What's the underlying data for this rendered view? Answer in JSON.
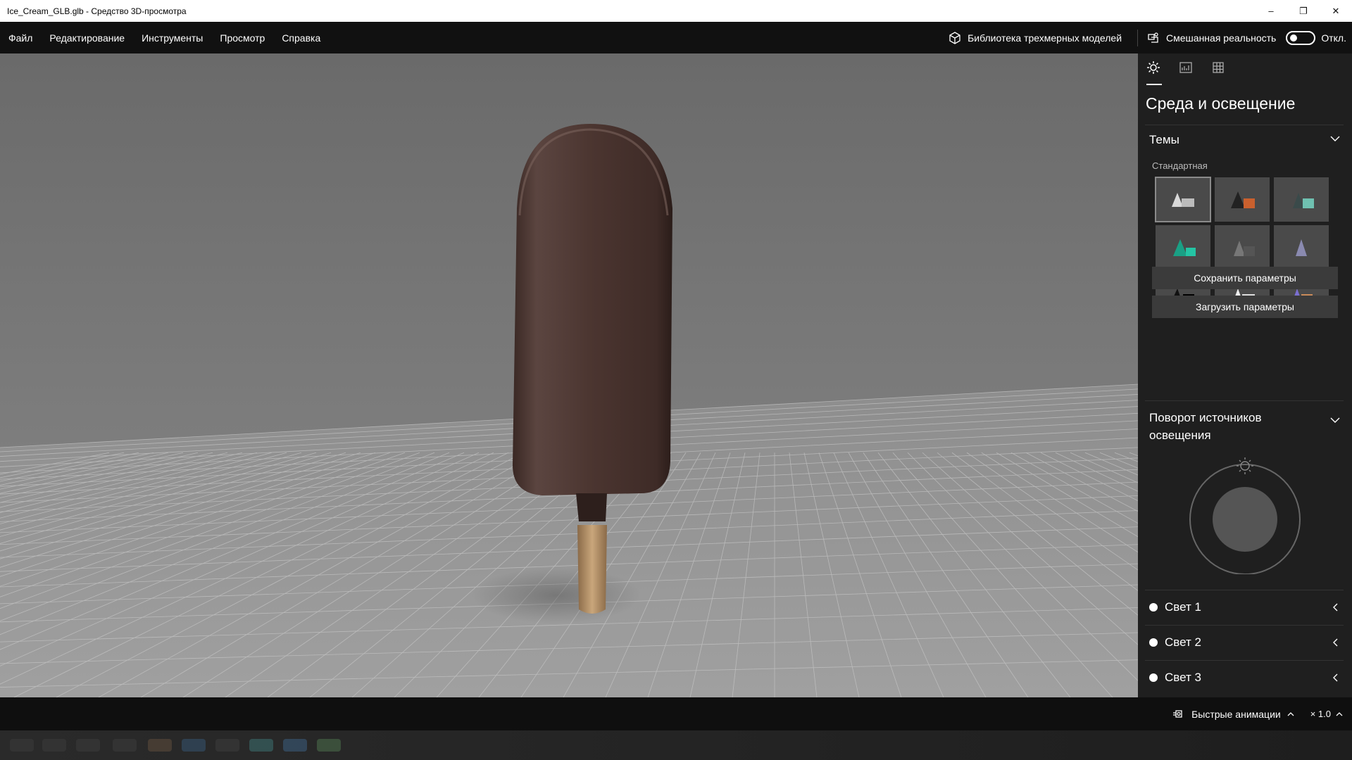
{
  "window": {
    "title": "Ice_Cream_GLB.glb - Средство 3D-просмотра",
    "minimize": "–",
    "restore": "❐",
    "close": "✕"
  },
  "menu": {
    "items": [
      "Файл",
      "Редактирование",
      "Инструменты",
      "Просмотр",
      "Справка"
    ]
  },
  "topbar": {
    "library_label": "Библиотека трехмерных моделей",
    "mixed_reality_label": "Смешанная реальность",
    "toggle_state": "Откл."
  },
  "panel": {
    "title": "Среда и освещение",
    "themes_header": "Темы",
    "themes_sub": "Стандартная",
    "save_button": "Сохранить параметры",
    "load_button": "Загрузить параметры",
    "rotation_header": "Поворот источников освещения",
    "lights": [
      "Свет 1",
      "Свет 2",
      "Свет 3"
    ]
  },
  "status": {
    "animations_label": "Быстрые анимации",
    "speed": "× 1.0"
  },
  "colors": {
    "accent": "#ffffff",
    "panel_bg": "#1f1f1f",
    "viewport_bg": "#7a7a7a"
  }
}
